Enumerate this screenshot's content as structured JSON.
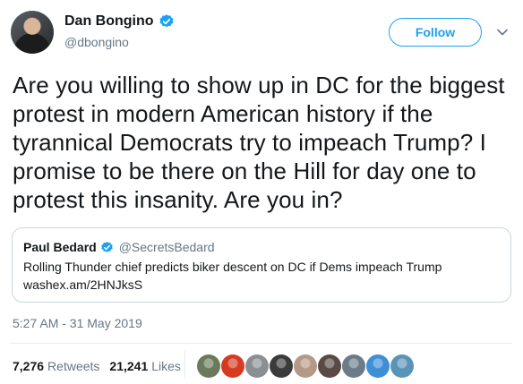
{
  "author": {
    "display_name": "Dan Bongino",
    "handle": "@dbongino",
    "avatar_icon": "avatar-photo",
    "verified_icon": "verified-badge-icon"
  },
  "actions": {
    "follow_label": "Follow",
    "more_icon": "chevron-down-icon"
  },
  "tweet": {
    "text": "Are you willing to show up in DC for the biggest protest in modern American history if the tyrannical Democrats try to impeach Trump? I promise to be there on the Hill for day one to protest this insanity. Are you in?",
    "timestamp": "5:27 AM - 31 May 2019"
  },
  "quoted": {
    "display_name": "Paul Bedard",
    "handle": "@SecretsBedard",
    "text": "Rolling Thunder chief predicts biker descent on DC if Dems impeach Trump",
    "link": "washex.am/2HNJksS"
  },
  "stats": {
    "retweets_count": "7,276",
    "retweets_label": "Retweets",
    "likes_count": "21,241",
    "likes_label": "Likes"
  },
  "likers": [
    {
      "icon": "liker-avatar-1",
      "color": "#6a7a5a"
    },
    {
      "icon": "liker-avatar-2",
      "color": "#d63a22"
    },
    {
      "icon": "liker-avatar-3",
      "color": "#8a8f94"
    },
    {
      "icon": "liker-avatar-4",
      "color": "#3b3b3b"
    },
    {
      "icon": "liker-avatar-5",
      "color": "#b49a86"
    },
    {
      "icon": "liker-avatar-6",
      "color": "#5a4a45"
    },
    {
      "icon": "liker-avatar-7",
      "color": "#6c7b88"
    },
    {
      "icon": "liker-avatar-8",
      "color": "#3d8fd6"
    },
    {
      "icon": "liker-avatar-9",
      "color": "#5b93b8"
    }
  ],
  "colors": {
    "accent": "#1da1f2",
    "text": "#14171a",
    "muted": "#657786",
    "border": "#ccd6dd"
  }
}
